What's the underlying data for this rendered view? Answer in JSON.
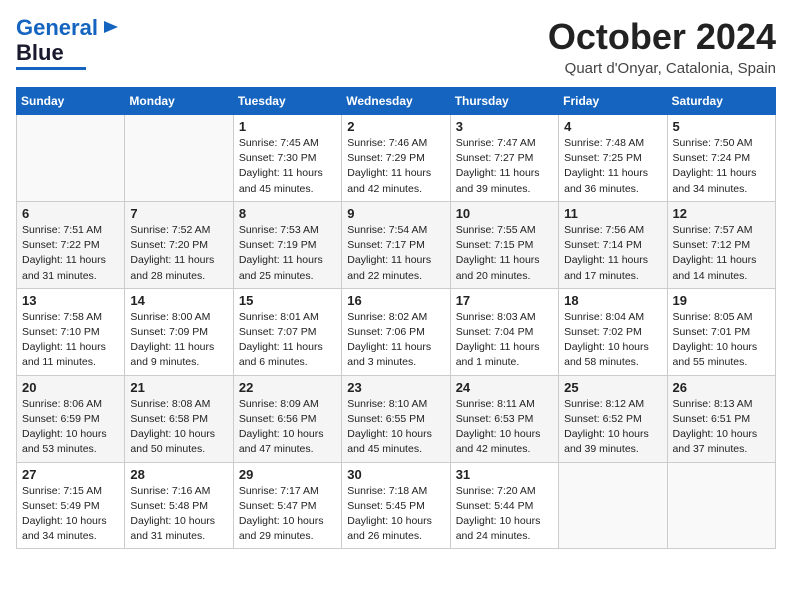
{
  "header": {
    "logo_line1": "General",
    "logo_line2": "Blue",
    "month": "October 2024",
    "location": "Quart d'Onyar, Catalonia, Spain"
  },
  "days_of_week": [
    "Sunday",
    "Monday",
    "Tuesday",
    "Wednesday",
    "Thursday",
    "Friday",
    "Saturday"
  ],
  "weeks": [
    [
      {
        "day": "",
        "info": ""
      },
      {
        "day": "",
        "info": ""
      },
      {
        "day": "1",
        "info": "Sunrise: 7:45 AM\nSunset: 7:30 PM\nDaylight: 11 hours\nand 45 minutes."
      },
      {
        "day": "2",
        "info": "Sunrise: 7:46 AM\nSunset: 7:29 PM\nDaylight: 11 hours\nand 42 minutes."
      },
      {
        "day": "3",
        "info": "Sunrise: 7:47 AM\nSunset: 7:27 PM\nDaylight: 11 hours\nand 39 minutes."
      },
      {
        "day": "4",
        "info": "Sunrise: 7:48 AM\nSunset: 7:25 PM\nDaylight: 11 hours\nand 36 minutes."
      },
      {
        "day": "5",
        "info": "Sunrise: 7:50 AM\nSunset: 7:24 PM\nDaylight: 11 hours\nand 34 minutes."
      }
    ],
    [
      {
        "day": "6",
        "info": "Sunrise: 7:51 AM\nSunset: 7:22 PM\nDaylight: 11 hours\nand 31 minutes."
      },
      {
        "day": "7",
        "info": "Sunrise: 7:52 AM\nSunset: 7:20 PM\nDaylight: 11 hours\nand 28 minutes."
      },
      {
        "day": "8",
        "info": "Sunrise: 7:53 AM\nSunset: 7:19 PM\nDaylight: 11 hours\nand 25 minutes."
      },
      {
        "day": "9",
        "info": "Sunrise: 7:54 AM\nSunset: 7:17 PM\nDaylight: 11 hours\nand 22 minutes."
      },
      {
        "day": "10",
        "info": "Sunrise: 7:55 AM\nSunset: 7:15 PM\nDaylight: 11 hours\nand 20 minutes."
      },
      {
        "day": "11",
        "info": "Sunrise: 7:56 AM\nSunset: 7:14 PM\nDaylight: 11 hours\nand 17 minutes."
      },
      {
        "day": "12",
        "info": "Sunrise: 7:57 AM\nSunset: 7:12 PM\nDaylight: 11 hours\nand 14 minutes."
      }
    ],
    [
      {
        "day": "13",
        "info": "Sunrise: 7:58 AM\nSunset: 7:10 PM\nDaylight: 11 hours\nand 11 minutes."
      },
      {
        "day": "14",
        "info": "Sunrise: 8:00 AM\nSunset: 7:09 PM\nDaylight: 11 hours\nand 9 minutes."
      },
      {
        "day": "15",
        "info": "Sunrise: 8:01 AM\nSunset: 7:07 PM\nDaylight: 11 hours\nand 6 minutes."
      },
      {
        "day": "16",
        "info": "Sunrise: 8:02 AM\nSunset: 7:06 PM\nDaylight: 11 hours\nand 3 minutes."
      },
      {
        "day": "17",
        "info": "Sunrise: 8:03 AM\nSunset: 7:04 PM\nDaylight: 11 hours\nand 1 minute."
      },
      {
        "day": "18",
        "info": "Sunrise: 8:04 AM\nSunset: 7:02 PM\nDaylight: 10 hours\nand 58 minutes."
      },
      {
        "day": "19",
        "info": "Sunrise: 8:05 AM\nSunset: 7:01 PM\nDaylight: 10 hours\nand 55 minutes."
      }
    ],
    [
      {
        "day": "20",
        "info": "Sunrise: 8:06 AM\nSunset: 6:59 PM\nDaylight: 10 hours\nand 53 minutes."
      },
      {
        "day": "21",
        "info": "Sunrise: 8:08 AM\nSunset: 6:58 PM\nDaylight: 10 hours\nand 50 minutes."
      },
      {
        "day": "22",
        "info": "Sunrise: 8:09 AM\nSunset: 6:56 PM\nDaylight: 10 hours\nand 47 minutes."
      },
      {
        "day": "23",
        "info": "Sunrise: 8:10 AM\nSunset: 6:55 PM\nDaylight: 10 hours\nand 45 minutes."
      },
      {
        "day": "24",
        "info": "Sunrise: 8:11 AM\nSunset: 6:53 PM\nDaylight: 10 hours\nand 42 minutes."
      },
      {
        "day": "25",
        "info": "Sunrise: 8:12 AM\nSunset: 6:52 PM\nDaylight: 10 hours\nand 39 minutes."
      },
      {
        "day": "26",
        "info": "Sunrise: 8:13 AM\nSunset: 6:51 PM\nDaylight: 10 hours\nand 37 minutes."
      }
    ],
    [
      {
        "day": "27",
        "info": "Sunrise: 7:15 AM\nSunset: 5:49 PM\nDaylight: 10 hours\nand 34 minutes."
      },
      {
        "day": "28",
        "info": "Sunrise: 7:16 AM\nSunset: 5:48 PM\nDaylight: 10 hours\nand 31 minutes."
      },
      {
        "day": "29",
        "info": "Sunrise: 7:17 AM\nSunset: 5:47 PM\nDaylight: 10 hours\nand 29 minutes."
      },
      {
        "day": "30",
        "info": "Sunrise: 7:18 AM\nSunset: 5:45 PM\nDaylight: 10 hours\nand 26 minutes."
      },
      {
        "day": "31",
        "info": "Sunrise: 7:20 AM\nSunset: 5:44 PM\nDaylight: 10 hours\nand 24 minutes."
      },
      {
        "day": "",
        "info": ""
      },
      {
        "day": "",
        "info": ""
      }
    ]
  ]
}
